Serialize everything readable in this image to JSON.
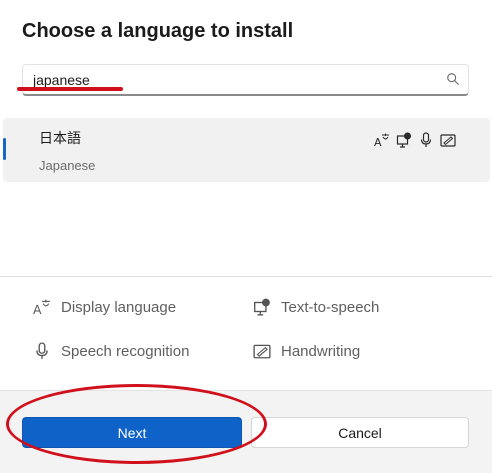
{
  "dialog": {
    "title": "Choose a language to install"
  },
  "search": {
    "value": "japanese",
    "icon": "search-icon"
  },
  "results": [
    {
      "native_name": "日本語",
      "english_name": "Japanese",
      "selected": true,
      "features": [
        "display-language-icon",
        "text-to-speech-icon",
        "speech-recognition-icon",
        "handwriting-icon"
      ]
    }
  ],
  "legend": {
    "display_language": "Display language",
    "text_to_speech": "Text-to-speech",
    "speech_recognition": "Speech recognition",
    "handwriting": "Handwriting"
  },
  "buttons": {
    "next": "Next",
    "cancel": "Cancel"
  },
  "colors": {
    "accent": "#0f62c8",
    "annotation_red": "#d0101a",
    "selection_bar": "#1767c4"
  }
}
